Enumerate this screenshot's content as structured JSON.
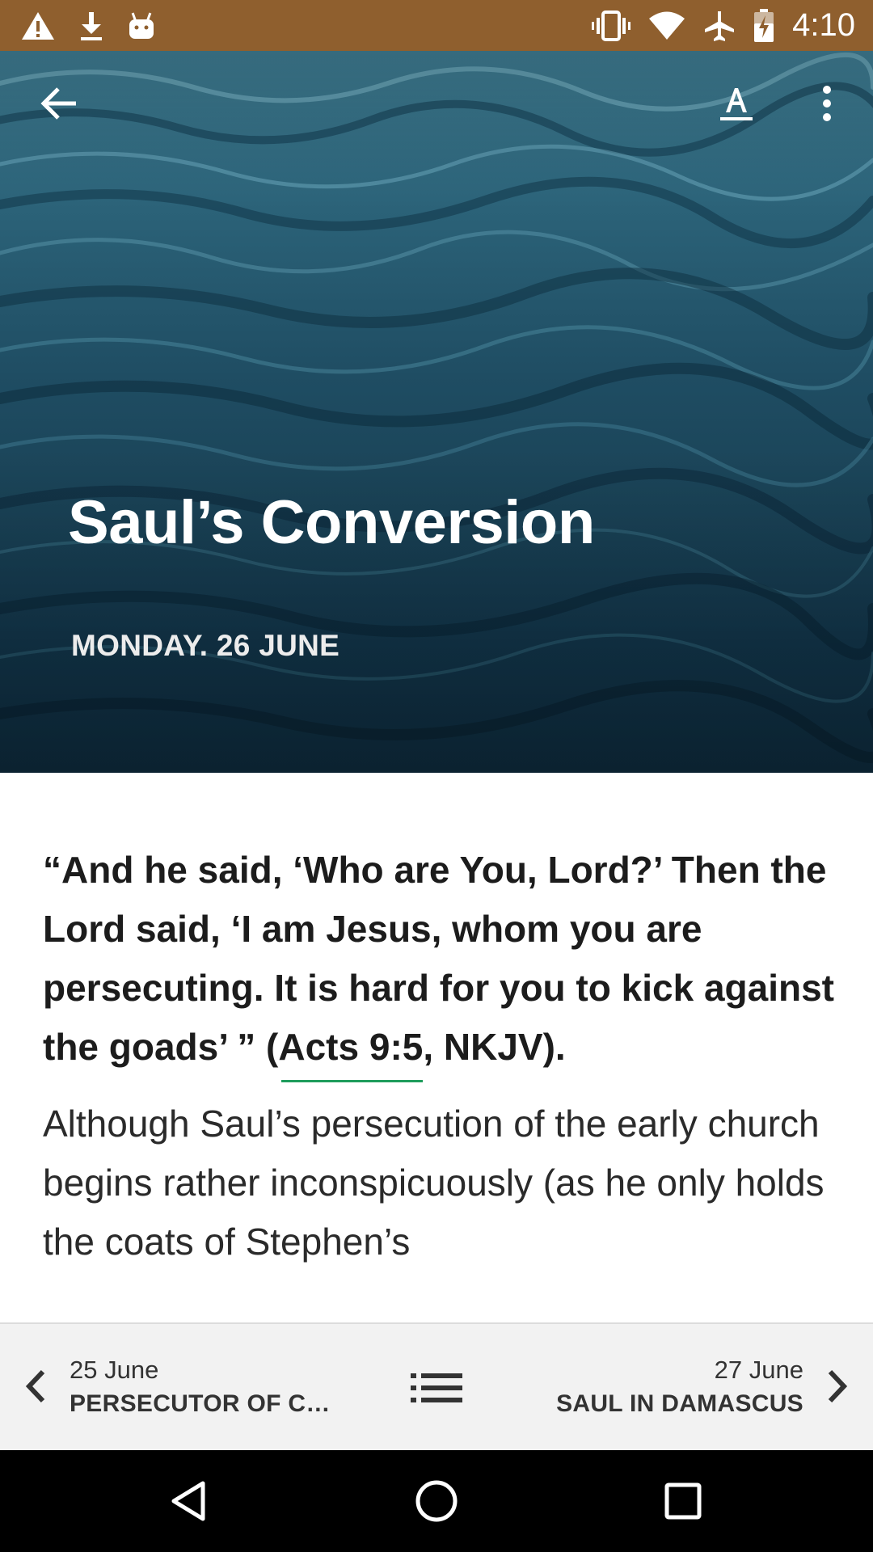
{
  "status_bar": {
    "time": "4:10",
    "left_icons": [
      "warning-icon",
      "download-icon",
      "android-icon"
    ],
    "right_icons": [
      "vibrate-icon",
      "wifi-icon",
      "airplane-icon",
      "battery-icon"
    ],
    "background_color": "#8f5f2e"
  },
  "toolbar": {
    "back_icon": "arrow-back-icon",
    "text_size_icon": "text-format-icon",
    "more_icon": "more-vert-icon"
  },
  "hero": {
    "title": "Saul’s Conversion",
    "date": "MONDAY. 26 JUNE"
  },
  "content": {
    "quote_part1": "“And he said, ‘Who are You, Lord?’ Then the Lord said, ‘I am Jesus, whom you are persecuting. It is hard for you to kick against the goads’ ” (",
    "quote_reference": "Acts 9:5",
    "quote_part2": ", NKJV).",
    "body": "Although Saul’s persecution of the early church begins rather inconspicuously (as he only holds the coats of Stephen’s",
    "link_color": "#1e9c5c"
  },
  "bottom_nav": {
    "prev": {
      "date": "25 June",
      "title": "PERSECUTOR OF CH..."
    },
    "next": {
      "date": "27 June",
      "title": "SAUL IN DAMASCUS"
    },
    "list_icon": "list-icon"
  },
  "system_nav": {
    "icons": [
      "back-triangle-icon",
      "home-circle-icon",
      "recents-square-icon"
    ]
  }
}
